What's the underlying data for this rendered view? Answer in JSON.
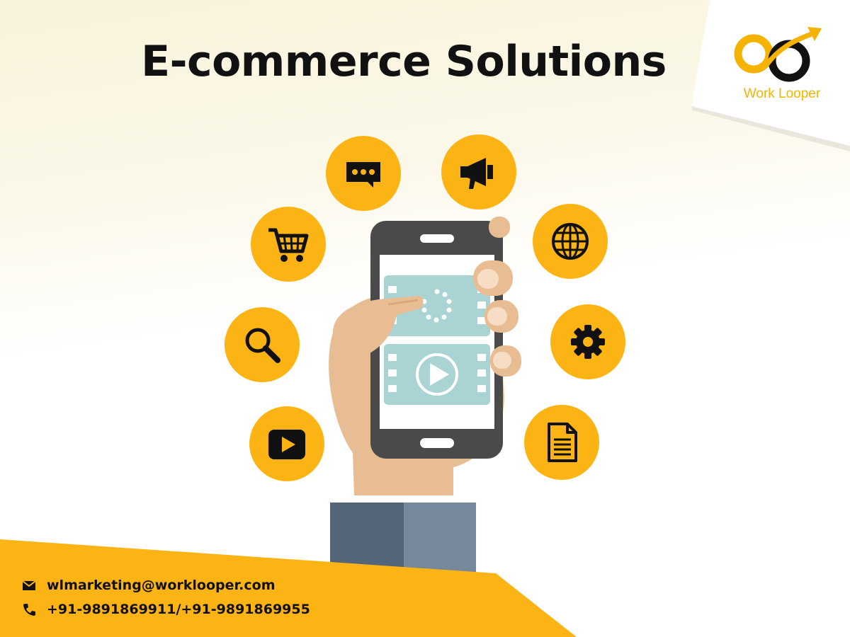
{
  "title": "E-commerce Solutions",
  "logo": {
    "text": "Work Looper"
  },
  "icons": [
    "chat-icon",
    "megaphone-icon",
    "shopping-cart-icon",
    "globe-icon",
    "search-icon",
    "gear-icon",
    "play-button-icon",
    "document-icon"
  ],
  "contact": {
    "email": "wlmarketing@worklooper.com",
    "phone": "+91-9891869911/+91-9891869955"
  },
  "colors": {
    "accent": "#fcb415",
    "text": "#111111",
    "phone_body": "#4a4a4a",
    "screen_tile": "#a9d4d3",
    "sleeve": "#5b6b80"
  }
}
